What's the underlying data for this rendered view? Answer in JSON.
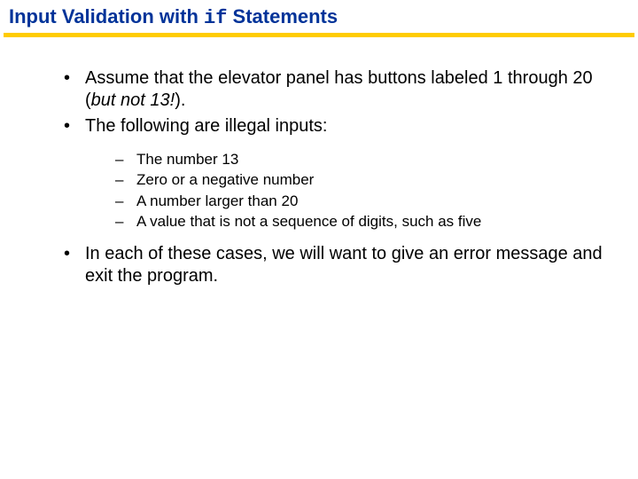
{
  "title": {
    "prefix": "Input Validation with ",
    "code": "if",
    "suffix": " Statements"
  },
  "bullets": {
    "b1": {
      "pre": "Assume that the elevator panel has buttons labeled 1 through 20 (",
      "emph": "but not 13!",
      "post": ")."
    },
    "b2": "The following are illegal inputs:",
    "sub": {
      "s1": "The number 13",
      "s2": "Zero or a negative number",
      "s3": "A number larger than 20",
      "s4": "A value that is not a sequence of digits, such as five"
    },
    "b3": "In each of these cases, we will want to give an error message and exit the program."
  }
}
